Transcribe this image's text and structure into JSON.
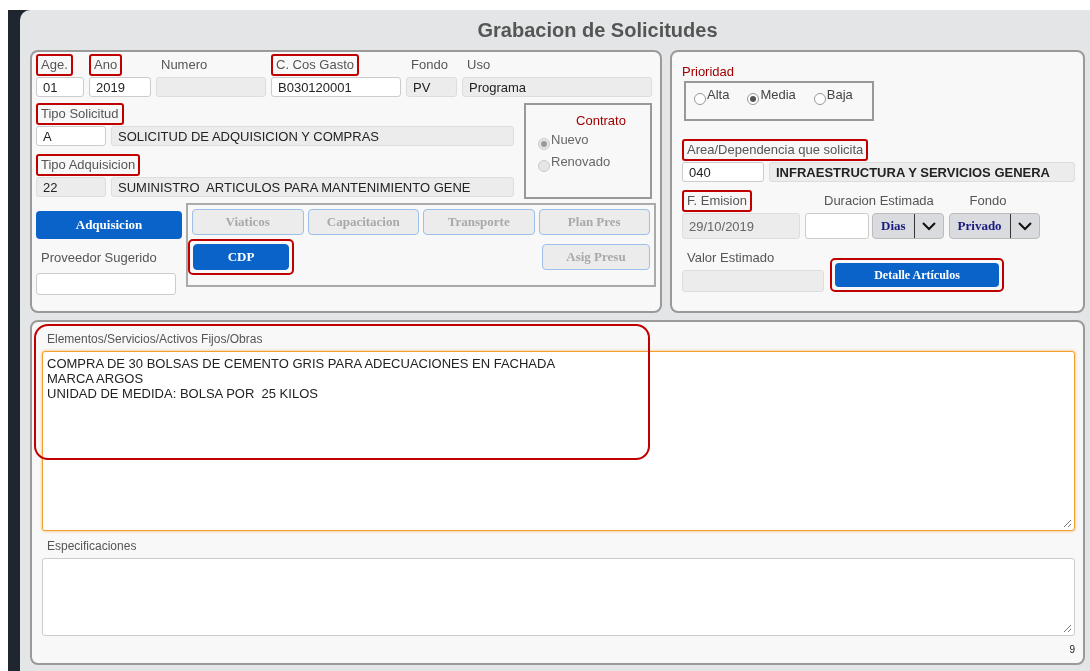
{
  "title": "Grabacion de Solicitudes",
  "general_fields": [
    {
      "label": "Age.",
      "value": "01",
      "kind": "editable",
      "highlighted": true
    },
    {
      "label": "Ano",
      "value": "2019",
      "kind": "editable",
      "highlighted": true
    },
    {
      "label": "Numero",
      "kind": "readonly",
      "highlighted": false
    },
    {
      "label": "C. Cos Gasto",
      "value": "B030120001",
      "kind": "editable",
      "highlighted": true
    },
    {
      "label": "Fondo",
      "value": "PV",
      "kind": "readonly",
      "highlighted": false
    },
    {
      "label": "Uso",
      "value": "Programa",
      "kind": "readonly",
      "highlighted": false
    }
  ],
  "tipo_solicitud": {
    "label": "Tipo Solicitud",
    "highlighted": true,
    "code": "A",
    "code_disabled": false,
    "description": "SOLICITUD DE ADQUISICION Y COMPRAS"
  },
  "tipo_adquisicion": {
    "label": "Tipo Adquisicion",
    "highlighted": true,
    "code": "22",
    "code_disabled": true,
    "description": "SUMINISTRO  ARTICULOS PARA MANTENIMIENTO GENE"
  },
  "contrato": {
    "title": "Contrato",
    "options": [
      {
        "label": "Nuevo",
        "selected": true,
        "disabled": true
      },
      {
        "label": "Renovado",
        "selected": false,
        "disabled": true
      }
    ]
  },
  "adquisicion_button": {
    "label": "Adquisicion"
  },
  "proveedor": {
    "label": "Proveedor Sugerido"
  },
  "button_rows": [
    [
      {
        "label": "Viaticos",
        "disabled": true,
        "highlighted": false
      },
      {
        "label": "Capacitacion",
        "disabled": true,
        "highlighted": false
      },
      {
        "label": "Transporte",
        "disabled": true,
        "highlighted": false
      },
      {
        "label": "Plan Pres",
        "disabled": true,
        "highlighted": false
      }
    ],
    [
      {
        "label": "CDP",
        "disabled": false,
        "highlighted": true
      },
      {
        "label": "Asig Presu",
        "disabled": true,
        "highlighted": false
      }
    ]
  ],
  "prioridad": {
    "label": "Prioridad",
    "options": [
      {
        "label": "Alta",
        "selected": false
      },
      {
        "label": "Media",
        "selected": true
      },
      {
        "label": "Baja",
        "selected": false
      }
    ]
  },
  "area": {
    "label": "Area/Dependencia que solicita",
    "highlighted": true,
    "code": "040",
    "description": "INFRAESTRUCTURA Y SERVICIOS GENERA"
  },
  "emision": {
    "label": "F. Emision",
    "highlighted": true,
    "value": "29/10/2019"
  },
  "duracion": {
    "label": "Duracion Estimada",
    "unit": "Dias"
  },
  "fondo": {
    "label": "Fondo",
    "value": "Privado"
  },
  "valor": {
    "label": "Valor Estimado"
  },
  "detalle_button": {
    "label": "Detalle Artículos",
    "highlighted": true
  },
  "elementos": {
    "label": "Elementos/Servicios/Activos Fijos/Obras",
    "highlighted": true,
    "focused": true,
    "value": "COMPRA DE 30 BOLSAS DE CEMENTO GRIS PARA ADECUACIONES EN FACHADA\nMARCA ARGOS\nUNIDAD DE MEDIDA: BOLSA POR  25 KILOS"
  },
  "especificaciones": {
    "label": "Especificaciones"
  },
  "page_number": "9"
}
